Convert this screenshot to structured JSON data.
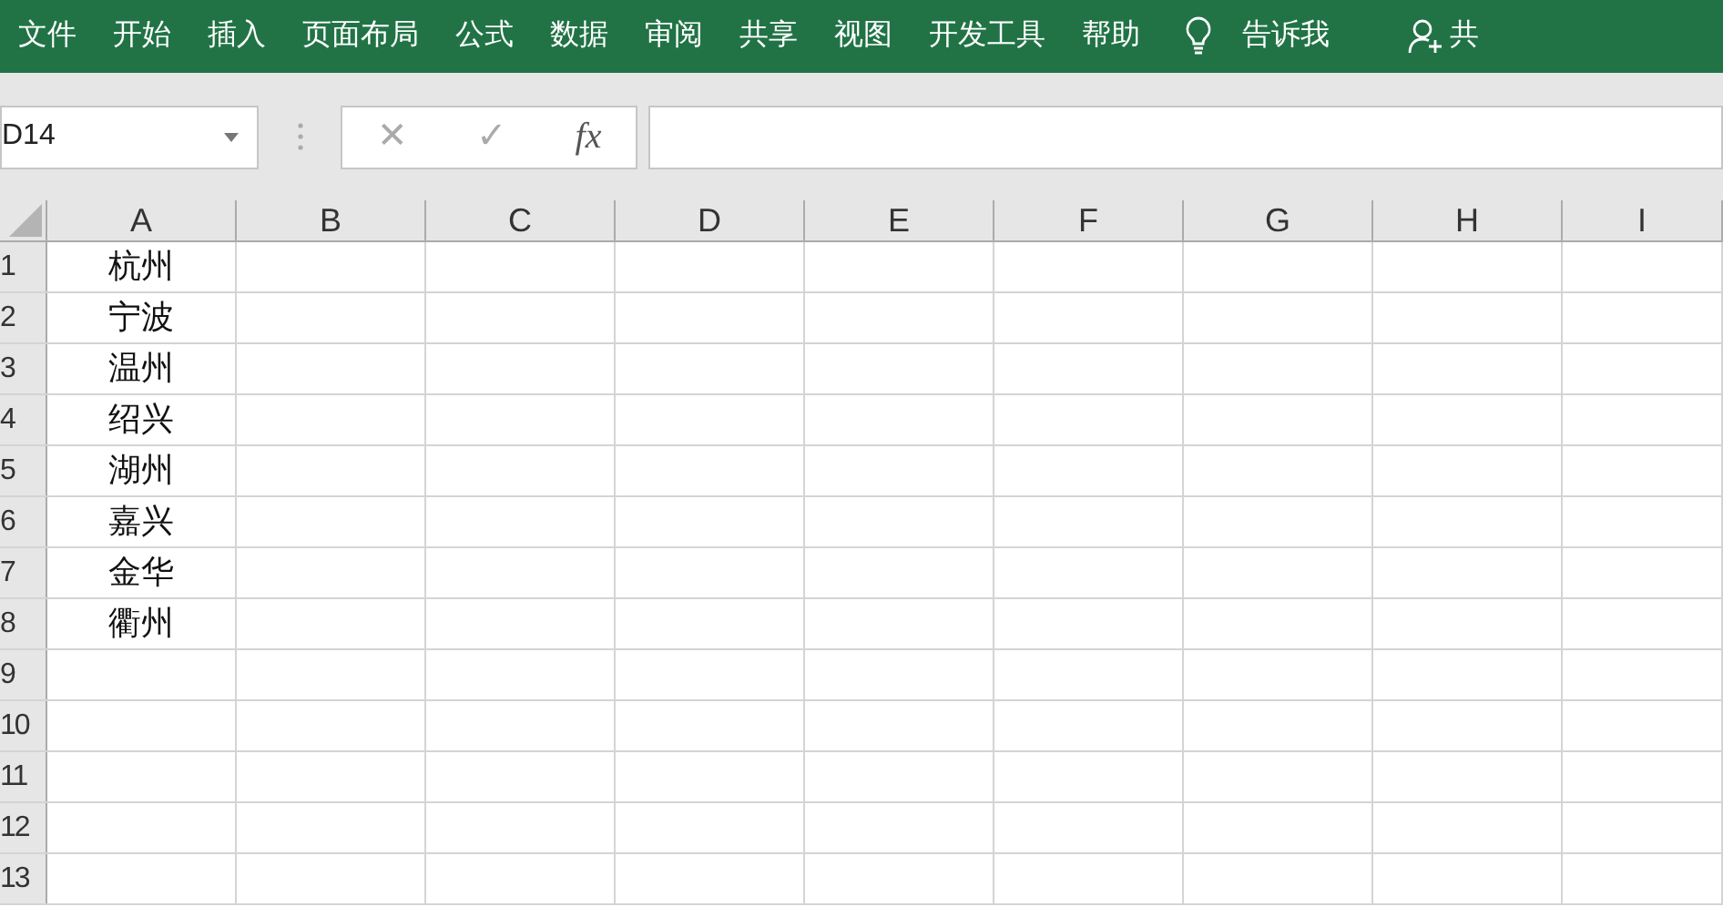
{
  "ribbon": {
    "tabs": [
      "文件",
      "开始",
      "插入",
      "页面布局",
      "公式",
      "数据",
      "审阅",
      "共享",
      "视图",
      "开发工具",
      "帮助"
    ],
    "tell_me": "告诉我",
    "share": "共"
  },
  "formula_bar": {
    "name_box": "D14",
    "cancel": "✕",
    "enter": "✓",
    "function": "fx"
  },
  "sheet": {
    "columns": [
      "A",
      "B",
      "C",
      "D",
      "E",
      "F",
      "G",
      "H",
      "I"
    ],
    "rows": [
      {
        "number": "1",
        "cells": [
          "杭州"
        ]
      },
      {
        "number": "2",
        "cells": [
          "宁波"
        ]
      },
      {
        "number": "3",
        "cells": [
          "温州"
        ]
      },
      {
        "number": "4",
        "cells": [
          "绍兴"
        ]
      },
      {
        "number": "5",
        "cells": [
          "湖州"
        ]
      },
      {
        "number": "6",
        "cells": [
          "嘉兴"
        ]
      },
      {
        "number": "7",
        "cells": [
          "金华"
        ]
      },
      {
        "number": "8",
        "cells": [
          "衢州"
        ]
      },
      {
        "number": "9",
        "cells": []
      },
      {
        "number": "10",
        "cells": []
      },
      {
        "number": "11",
        "cells": []
      },
      {
        "number": "12",
        "cells": []
      },
      {
        "number": "13",
        "cells": []
      }
    ]
  }
}
